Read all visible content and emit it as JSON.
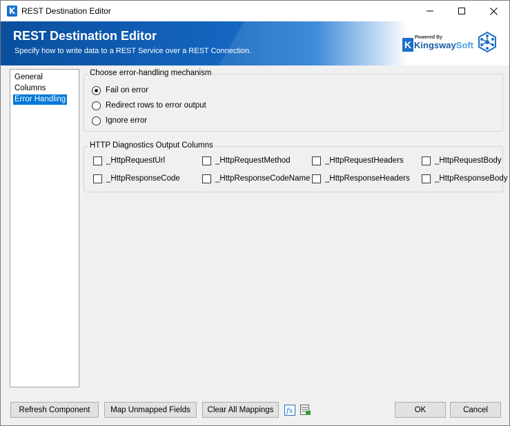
{
  "window": {
    "title": "REST Destination Editor",
    "app_icon": "K",
    "icons": {
      "minimize": "minimize-icon",
      "maximize": "maximize-icon",
      "close": "close-icon"
    }
  },
  "banner": {
    "title": "REST Destination Editor",
    "subtitle": "Specify how to write data to a REST Service over a REST Connection.",
    "logo": {
      "powered_by": "Powered By",
      "brand_a": "Kingsway",
      "brand_b": "Soft",
      "k_letter": "K"
    },
    "colors": {
      "primary": "#0a4f9e",
      "accent": "#2a7fd6"
    }
  },
  "nav": {
    "items": [
      {
        "label": "General",
        "selected": false
      },
      {
        "label": "Columns",
        "selected": false
      },
      {
        "label": "Error Handling",
        "selected": true
      }
    ]
  },
  "error_handling": {
    "group_label": "Choose error-handling mechanism",
    "options": [
      {
        "label": "Fail on error",
        "checked": true
      },
      {
        "label": "Redirect rows to error output",
        "checked": false
      },
      {
        "label": "Ignore error",
        "checked": false
      }
    ]
  },
  "diagnostics": {
    "group_label": "HTTP Diagnostics Output Columns",
    "columns": [
      {
        "label": "_HttpRequestUrl",
        "checked": false
      },
      {
        "label": "_HttpRequestMethod",
        "checked": false
      },
      {
        "label": "_HttpRequestHeaders",
        "checked": false
      },
      {
        "label": "_HttpRequestBody",
        "checked": false
      },
      {
        "label": "_HttpResponseCode",
        "checked": false
      },
      {
        "label": "_HttpResponseCodeName",
        "checked": false
      },
      {
        "label": "_HttpResponseHeaders",
        "checked": false
      },
      {
        "label": "_HttpResponseBody",
        "checked": false
      }
    ]
  },
  "footer": {
    "refresh_label": "Refresh Component",
    "map_unmapped_label": "Map Unmapped Fields",
    "clear_mappings_label": "Clear All Mappings",
    "fx_icon": "expression-fx-icon",
    "grid_icon": "export-grid-icon",
    "ok_label": "OK",
    "cancel_label": "Cancel"
  }
}
